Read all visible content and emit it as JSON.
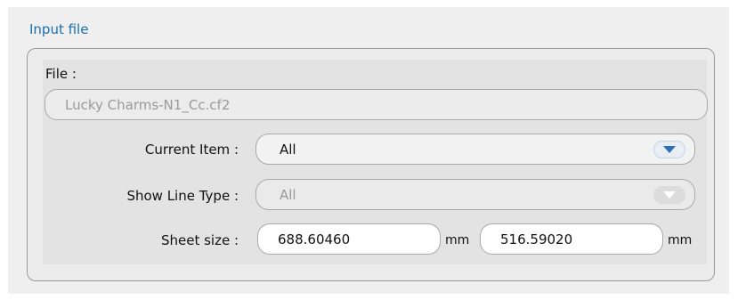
{
  "group": {
    "title": "Input file"
  },
  "file": {
    "label": "File :",
    "value": "Lucky Charms-N1_Cc.cf2"
  },
  "current_item": {
    "label": "Current Item :",
    "value": "All"
  },
  "show_line_type": {
    "label": "Show Line Type :",
    "value": "All"
  },
  "sheet_size": {
    "label": "Sheet size :",
    "width": "688.60460",
    "width_unit": "mm",
    "height": "516.59020",
    "height_unit": "mm"
  },
  "colors": {
    "title_blue": "#1a6fb0",
    "dropdown_arrow_active": "#2f6db5",
    "dropdown_arrow_disabled": "#ffffff"
  }
}
